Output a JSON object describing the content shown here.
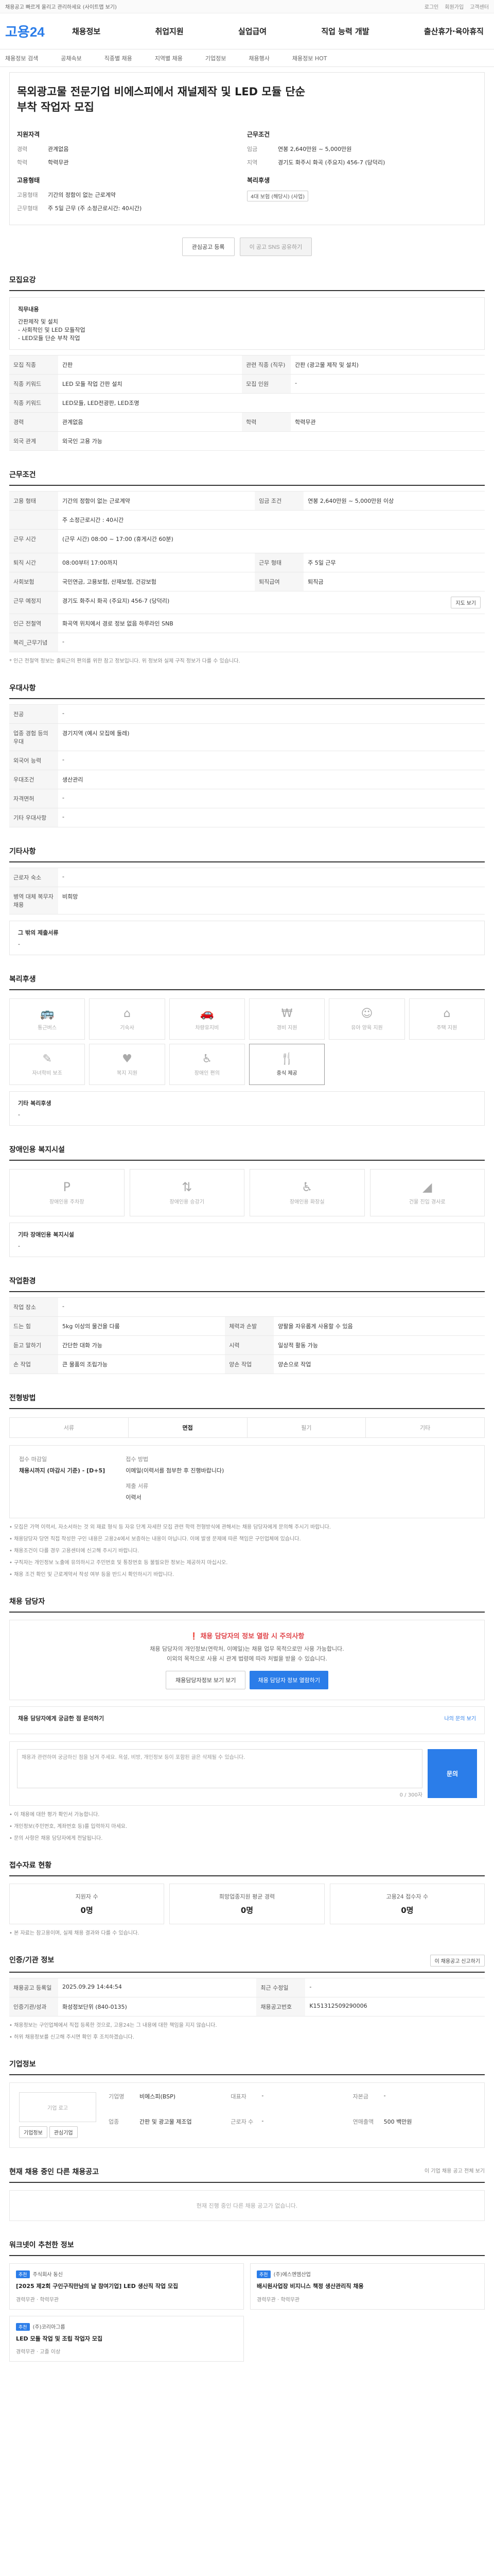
{
  "topbar": {
    "notice": "채용공고 빠르게 올리고 관리하세요 (사이트맵 보기)",
    "links": [
      "로그인",
      "회원가입",
      "고객센터"
    ]
  },
  "header": {
    "logo": "고용24",
    "nav": [
      "채용정보",
      "취업지원",
      "실업급여",
      "직업 능력 개발",
      "출산휴가·육아휴직"
    ]
  },
  "subnav": [
    "채용정보 검색",
    "공채속보",
    "직종별 채용",
    "지역별 채용",
    "기업정보",
    "채용행사",
    "채용정보 HOT"
  ],
  "job": {
    "title": "목외광고물 전문기업 비에스피에서 재널제작 및 LED 모듈 단순 부착 작업자 모집",
    "summary_left_title": "지원자격",
    "summary_left": [
      {
        "k": "경력",
        "v": "관계없음"
      },
      {
        "k": "학력",
        "v": "학력무관"
      }
    ],
    "condition_title": "고용형태",
    "condition_left": [
      {
        "k": "고용형태",
        "v": "기간의 정함이 없는 근로계약"
      },
      {
        "k": "근무형태",
        "v": "주 5일 근무 (주 소정근로시간: 40시간)"
      }
    ],
    "summary_right_title": "근무조건",
    "summary_right": [
      {
        "k": "임금",
        "v": "연봉 2,640만원 ~ 5,000만원"
      },
      {
        "k": "지역",
        "v": "경기도 화주시 화곡 (주요지) 456-7 (당덕리)"
      }
    ],
    "benefit_title": "복리후생",
    "benefit_tag": "4대 보험 (해당시) (사업)",
    "btn_scrap": "관심공고 등록",
    "btn_share": "이 공고 SNS 공유하기"
  },
  "recruit": {
    "title": "모집요강",
    "duty_label": "직무내용",
    "duties": [
      "간판제작 및 설치",
      "- 사회적인 및 LED 모듈작업",
      "- LED모듈 단순 부착 작업"
    ],
    "rows": [
      {
        "h": "모집 직종",
        "v": "간판",
        "h2": "관련 직종 (직무)",
        "v2": "간판 (광고물 제작 및 설치)"
      },
      {
        "h": "직종 키워드",
        "v": "LED 모듈 작업 간판 설치",
        "h2": "모집 인원",
        "v2": "-"
      },
      {
        "h": "직종 키워드",
        "v": "LED모듈, LED전광판, LED조명",
        "h2": "",
        "v2": ""
      },
      {
        "h": "경력",
        "v": "관계없음",
        "h2": "학력",
        "v2": "학력무관"
      },
      {
        "h": "외국 관계",
        "v": "외국인 고용 가능",
        "h2": "",
        "v2": ""
      }
    ]
  },
  "work": {
    "title": "근무조건",
    "rows": [
      {
        "h": "고용 형태",
        "v": "기간의 정함이 없는 근로계약",
        "h2": "임금 조건",
        "v2": "연봉 2,640만원 ~ 5,000만원 이상"
      },
      {
        "h": "",
        "v": "주 소정근로시간 : 40시간",
        "h2": "",
        "v2": ""
      },
      {
        "h": "근무 시간",
        "v": "(근무 시간) 08:00 ~ 17:00 (휴게시간 60분)",
        "h2": "",
        "v2": ""
      },
      {
        "h": "퇴직 시간",
        "v": "08:00부터 17:00까지",
        "h2": "근무 형태",
        "v2": "주 5일 근무"
      },
      {
        "h": "사회보험",
        "v": "국민연금, 고용보험, 산재보험, 건강보험",
        "h2": "퇴직급여",
        "v2": "퇴직금"
      },
      {
        "h": "근무 예정지",
        "v": "경기도 화주시 화곡 (주요지) 456-7 (당덕리)",
        "h2": "",
        "v2": ""
      },
      {
        "h": "인근 전철역",
        "v": "화곡역 위치에서 경로 정보 없음 하루라인 SNB",
        "h2": "",
        "v2": ""
      },
      {
        "h": "복리_근무기념",
        "v": "-",
        "h2": "",
        "v2": ""
      }
    ],
    "map_btn": "지도 보기",
    "note": "* 인근 전철역 정보는 출퇴근의 편의를 위한 참고 정보입니다. 위 정보와 실제 구직 정보가 다를 수 있습니다."
  },
  "prefer": {
    "title": "우대사항",
    "rows": [
      {
        "h": "전공",
        "v": "-"
      },
      {
        "h": "업종 경험 등의 우대",
        "v": "경기지역 (예시 모집에 둘레)"
      },
      {
        "h": "외국어 능력",
        "v": "-"
      },
      {
        "h": "우대조건",
        "v": "생산관리"
      },
      {
        "h": "자격면허",
        "v": "-"
      },
      {
        "h": "기타 우대사항",
        "v": "-"
      }
    ]
  },
  "etc": {
    "title": "기타사항",
    "rows": [
      {
        "h": "근로자 숙소",
        "v": "-"
      },
      {
        "h": "병역 대체 복무자 채용",
        "v": "비희망"
      }
    ],
    "extra_label": "그 밖의 제출서류",
    "extra_value": "-"
  },
  "welfare": {
    "title": "복리후생",
    "items": [
      {
        "label": "통근버스",
        "icon": "bus-icon",
        "glyph": "🚌",
        "on": false
      },
      {
        "label": "기숙사",
        "icon": "dorm-icon",
        "glyph": "⌂",
        "on": false
      },
      {
        "label": "차량유지비",
        "icon": "car-icon",
        "glyph": "🚗",
        "on": false
      },
      {
        "label": "경비 지원",
        "icon": "wallet-icon",
        "glyph": "₩",
        "on": false
      },
      {
        "label": "유아 양육 지원",
        "icon": "baby-icon",
        "glyph": "☺",
        "on": false
      },
      {
        "label": "주택 지원",
        "icon": "house-icon",
        "glyph": "⌂",
        "on": false
      },
      {
        "label": "자녀학비 보조",
        "icon": "book-icon",
        "glyph": "✎",
        "on": false
      },
      {
        "label": "복지 지원",
        "icon": "heart-icon",
        "glyph": "♥",
        "on": false
      },
      {
        "label": "장애인 편의",
        "icon": "wheelchair-icon",
        "glyph": "♿",
        "on": false
      },
      {
        "label": "중식 제공",
        "icon": "meal-icon",
        "glyph": "🍴",
        "on": true
      }
    ],
    "other_label": "기타 복리후생",
    "other_value": "-"
  },
  "disability": {
    "title": "장애인용 복지시설",
    "items": [
      {
        "label": "장애인용 주차장",
        "icon": "parking-icon",
        "glyph": "P"
      },
      {
        "label": "장애인용 승강기",
        "icon": "elevator-icon",
        "glyph": "⇅"
      },
      {
        "label": "장애인용 화장실",
        "icon": "toilet-icon",
        "glyph": "♿"
      },
      {
        "label": "건물 진입 경사로",
        "icon": "ramp-icon",
        "glyph": "◢"
      }
    ],
    "other_label": "기타 장애인용 복지시설",
    "other_value": "-"
  },
  "disabled_work": {
    "title": "작업환경",
    "rows": [
      {
        "h": "작업 장소",
        "v": "-",
        "h2": "",
        "v2": ""
      },
      {
        "h": "드는 힘",
        "v": "5kg 이상의 물건을 다룸",
        "h2": "체력과 손발",
        "v2": "양팔을 자유롭게 사용할 수 있음"
      },
      {
        "h": "듣고 말하기",
        "v": "간단한 대화 가능",
        "h2": "시력",
        "v2": "일상적 활동 가능"
      },
      {
        "h": "손 작업",
        "v": "큰 물품의 조립가능",
        "h2": "양손 작업",
        "v2": "양손으로 작업"
      }
    ]
  },
  "process": {
    "title": "전형방법",
    "steps": [
      {
        "label": "서류",
        "on": false
      },
      {
        "label": "면접",
        "on": true
      },
      {
        "label": "필기",
        "on": false
      },
      {
        "label": "기타",
        "on": false
      }
    ],
    "apply_k1": "접수 마감일",
    "apply_v1": "채용시까지 (마감시 기준) - [D+5]",
    "apply_k2": "접수 방법",
    "apply_v2": "지원 방법",
    "apply_v2b": "이메일(이력서를 첨부한 후 진행바랍니다)",
    "apply_k3": "제출 서류",
    "apply_v3": "이력서",
    "notes": [
      "• 모집은 가역 이력서, 자소서하는 것 외 재료 형식 등 자유 단계 자세한 모집 관련 학력 전형방식에 관해서는 채용 담당자에게 문의해 주시기 바랍니다.",
      "• 채용담당자 당연 직접 작성한 구인 내용은 고용24에서 보증하는 내용이 아닙니다. 이에 발생 문제에 따른 책임은 구인업체에 있습니다.",
      "• 채용조건이 다를 경우 고용센터에 신고해 주시기 바랍니다.",
      "• 구직자는 개인정보 노출에 유의하시고 주민번호 및 통장번호 등 불필요한 정보는 제공하지 마십시오.",
      "• 채용 조건 확인 및 근로계약서 작성 여부 등을 반드시 확인하시기 바랍니다."
    ]
  },
  "contact": {
    "title": "채용 담당자",
    "warn": "채용 담당자의 정보 열람 시 주의사항",
    "desc1": "채용 담당자의 개인정보(연락처, 이메일)는 채용 업무 목적으로만 사용 가능합니다.",
    "desc2": "이외의 목적으로 사용 시 관계 법령에 따라 처벌을 받을 수 있습니다.",
    "btn1": "채용담당자정보 보기 보기",
    "btn2": "채용 담당자 정보 열람하기",
    "qa_title": "채용 담당자에게 궁금한 점 문의하기",
    "qa_link": "나의 문의 보기",
    "qa_placeholder": "채용과 관련하여 궁금하신 점을 남겨 주세요. 욕설, 비방, 개인정보 등이 포함된 글은 삭제될 수 있습니다.",
    "qa_count": "0 / 300자",
    "qa_send": "문의",
    "notes": [
      "• 이 채용에 대한 평가 확인서 가능합니다.",
      "• 개인정보(주민번호, 계좌번호 등)를 입력하지 마세요.",
      "• 문의 사항은 채용 담당자에게 전달됩니다."
    ]
  },
  "stats": {
    "title": "접수자료 현황",
    "items": [
      {
        "k": "지원자 수",
        "v": "0명"
      },
      {
        "k": "희망업종지원 평균 경력",
        "v": "0명"
      },
      {
        "k": "고용24 접수자 수",
        "v": "0명"
      }
    ],
    "note": "• 본 자료는 참고용이며, 실제 채용 결과와 다를 수 있습니다."
  },
  "info": {
    "title": "인증/기관 정보",
    "btn": "이 채용공고 신고하기",
    "rows": [
      {
        "h": "채용공고 등록일",
        "v": "2025.09.29 14:44:54",
        "h2": "최근 수정일",
        "v2": "-"
      },
      {
        "h": "인증기관/성과",
        "v": "화성정보단위 (840-0135)",
        "h2": "채용공고번호",
        "v2": "K151312509290006"
      }
    ],
    "notes": [
      "• 채용정보는 구인업체에서 직접 등록한 것으로, 고용24는 그 내용에 대한 책임을 지지 않습니다.",
      "• 허위 채용정보를 신고해 주시면 확인 후 조치하겠습니다."
    ]
  },
  "corp": {
    "title": "기업정보",
    "logo_text": "기업 로고",
    "btn_info": "기업정보",
    "btn_fav": "관심기업",
    "fields": [
      {
        "k": "기업명",
        "v": "비에스피(BSP)"
      },
      {
        "k": "업종",
        "v": "간판 및 광고물 제조업"
      },
      {
        "k": "대표자",
        "v": "-"
      },
      {
        "k": "근로자 수",
        "v": "-"
      },
      {
        "k": "자본금",
        "v": "-"
      },
      {
        "k": "연매출액",
        "v": "500 백만원"
      }
    ]
  },
  "others": {
    "title": "현재 채용 중인 다른 채용공고",
    "link": "이 기업 채용 공고 전체 보기",
    "empty": "현재 진행 중인 다른 채용 공고가 없습니다."
  },
  "recommend": {
    "title": "워크넷이 추천한 정보",
    "items": [
      {
        "badge": "추천",
        "company": "주식회사 동신",
        "title": "[2025 제2회 구인구직만남의 날 참여기업] LED 생산직 작업 모집",
        "meta": "경력무관 · 학력무관"
      },
      {
        "badge": "추천",
        "company": "(주)에스엔엠산업",
        "title": "배시원사업장 비지니스 책정 생산관리직 채용",
        "meta": "경력무관 · 학력무관"
      },
      {
        "badge": "추천",
        "company": "(주)코리아그룹",
        "title": "LED 모듈 작업 및 조립 작업자 모집",
        "meta": "경력무관 · 고졸 이상"
      }
    ]
  }
}
